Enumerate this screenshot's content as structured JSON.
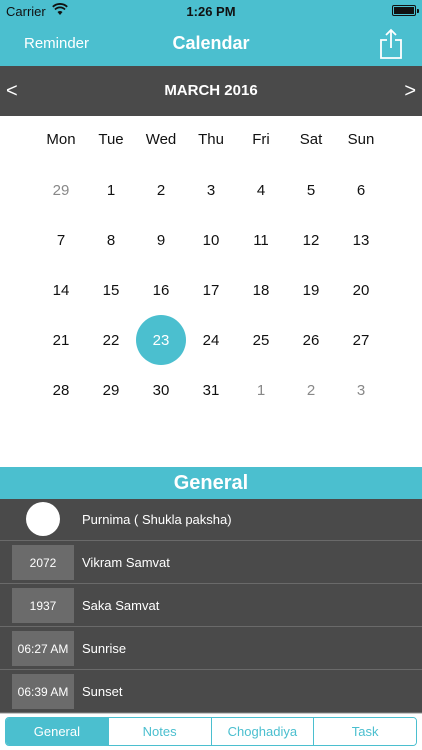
{
  "status_bar": {
    "carrier": "Carrier",
    "time": "1:26 PM"
  },
  "nav": {
    "left_button": "Reminder",
    "title": "Calendar",
    "right_icon": "share-icon"
  },
  "month_bar": {
    "prev": "<",
    "month": "MARCH 2016",
    "next": ">"
  },
  "weekdays": [
    "Mon",
    "Tue",
    "Wed",
    "Thu",
    "Fri",
    "Sat",
    "Sun"
  ],
  "weeks": [
    [
      "29",
      "1",
      "2",
      "3",
      "4",
      "5",
      "6"
    ],
    [
      "7",
      "8",
      "9",
      "10",
      "11",
      "12",
      "13"
    ],
    [
      "14",
      "15",
      "16",
      "17",
      "18",
      "19",
      "20"
    ],
    [
      "21",
      "22",
      "23",
      "24",
      "25",
      "26",
      "27"
    ],
    [
      "28",
      "29",
      "30",
      "31",
      "1",
      "2",
      "3"
    ]
  ],
  "muted_days": [
    [
      0,
      0
    ],
    [
      4,
      4
    ],
    [
      4,
      5
    ],
    [
      4,
      6
    ]
  ],
  "selected_day": [
    3,
    2
  ],
  "general": {
    "title": "General",
    "rows": [
      {
        "value": "",
        "label": "Purnima ( Shukla paksha)"
      },
      {
        "value": "2072",
        "label": "Vikram Samvat"
      },
      {
        "value": "1937",
        "label": "Saka Samvat"
      },
      {
        "value": "06:27 AM",
        "label": "Sunrise"
      },
      {
        "value": "06:39 AM",
        "label": "Sunset"
      }
    ]
  },
  "tabs": [
    {
      "label": "General",
      "active": true
    },
    {
      "label": "Notes",
      "active": false
    },
    {
      "label": "Choghadiya",
      "active": false
    },
    {
      "label": "Task",
      "active": false
    }
  ],
  "colors": {
    "accent": "#4bbfcf",
    "dark": "#4a4a4a",
    "badge": "#6b6b6b"
  }
}
